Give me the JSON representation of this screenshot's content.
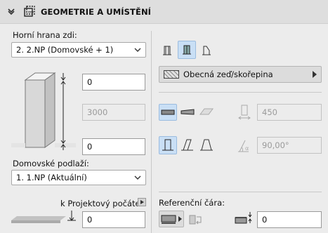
{
  "header": {
    "title": "GEOMETRIE A UMÍSTĚNÍ",
    "chevron_icon": "chevron-down-icon",
    "section_icon": "wall-geometry-icon"
  },
  "left": {
    "top_edge_label": "Horní hrana zdi:",
    "top_edge_value": "2. 2.NP (Domovské + 1)",
    "top_offset": "0",
    "height": "3000",
    "bottom_offset": "0",
    "home_floor_label": "Domovské podlaží:",
    "home_floor_value": "1. 1.NP (Aktuální)",
    "project_origin_label": "k Projektový počátek",
    "project_origin_value": "0"
  },
  "right": {
    "composite_label": "Obecná zeď/skořepina",
    "thickness": "450",
    "angle": "90,00°",
    "reference_line_label": "Referenční čára:",
    "reference_offset": "0"
  },
  "colors": {
    "selected_bg": "#c9dff5",
    "panel_bg": "#ececec",
    "header_bg": "#dedede"
  }
}
